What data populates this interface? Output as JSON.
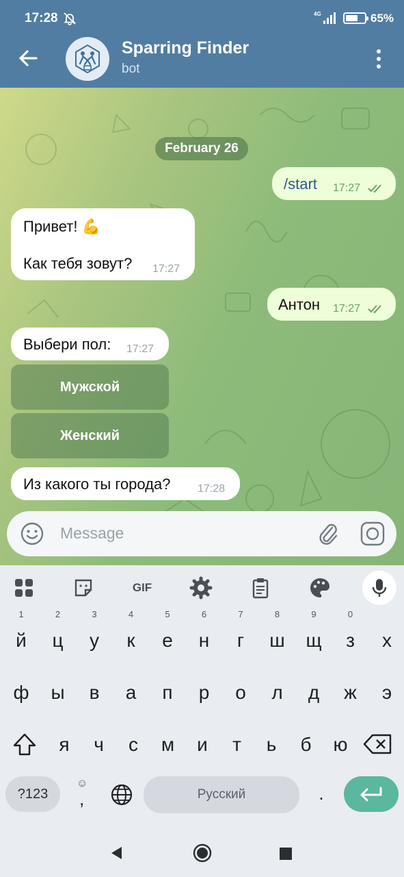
{
  "status_bar": {
    "time": "17:28",
    "network": "4G",
    "battery_level": 0.65,
    "battery_text": "65%"
  },
  "header": {
    "title": "Sparring Finder",
    "subtitle": "bot"
  },
  "date_separator": "February 26",
  "messages": [
    {
      "side": "out",
      "text": "/start",
      "time": "17:27"
    },
    {
      "side": "in",
      "line1": "Привет! 💪",
      "line2": "Как тебя зовут?",
      "time": "17:27"
    },
    {
      "side": "out",
      "text": "Антон",
      "time": "17:27"
    },
    {
      "side": "in",
      "text": "Выбери пол:",
      "time": "17:27"
    },
    {
      "side": "in",
      "text": "Из какого ты города?",
      "time": "17:28"
    }
  ],
  "inline_keyboard": [
    "Мужской",
    "Женский"
  ],
  "composer": {
    "placeholder": "Message"
  },
  "keyboard_toolbar": {
    "gif_label": "GIF"
  },
  "keyboard": {
    "row1": [
      "й",
      "ц",
      "у",
      "к",
      "е",
      "н",
      "г",
      "ш",
      "щ",
      "з",
      "х"
    ],
    "row1_hints": [
      "1",
      "2",
      "3",
      "4",
      "5",
      "6",
      "7",
      "8",
      "9",
      "0",
      ""
    ],
    "row2": [
      "ф",
      "ы",
      "в",
      "а",
      "п",
      "р",
      "о",
      "л",
      "д",
      "ж",
      "э"
    ],
    "row3": [
      "я",
      "ч",
      "с",
      "м",
      "и",
      "т",
      "ь",
      "б",
      "ю"
    ],
    "symbols_key": "?123",
    "comma_key": ",",
    "space_label": "Русский",
    "period_key": "."
  },
  "colors": {
    "header": "#517da2",
    "incoming": "#ffffff",
    "outgoing": "#eefed8",
    "enter_key": "#5bb7a0"
  }
}
